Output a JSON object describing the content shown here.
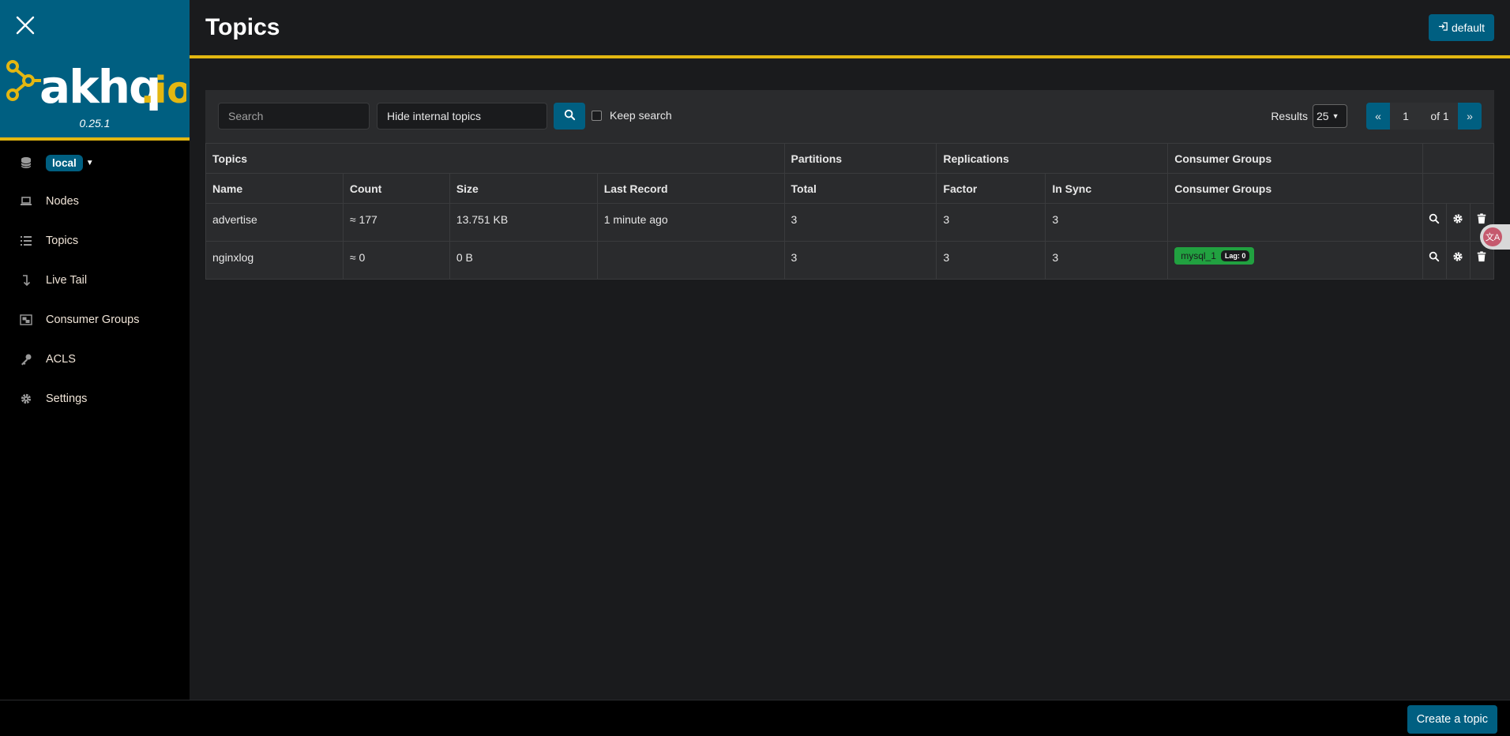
{
  "app": {
    "version": "0.25.1"
  },
  "sidebar": {
    "cluster": "local",
    "items": [
      {
        "label": "Nodes",
        "icon": "laptop-icon"
      },
      {
        "label": "Topics",
        "icon": "list-icon"
      },
      {
        "label": "Live Tail",
        "icon": "level-down-icon"
      },
      {
        "label": "Consumer Groups",
        "icon": "object-group-icon"
      },
      {
        "label": "ACLS",
        "icon": "key-icon"
      },
      {
        "label": "Settings",
        "icon": "gear-icon"
      }
    ]
  },
  "header": {
    "title": "Topics",
    "default_label": "default"
  },
  "search": {
    "placeholder": "Search",
    "internal_filter": "Hide internal topics",
    "keep_label": "Keep search",
    "results_label": "Results",
    "page_size": "25"
  },
  "pager": {
    "prev": "«",
    "current": "1",
    "total": "of 1",
    "next": "»"
  },
  "table": {
    "group_headers": [
      "Topics",
      "Partitions",
      "Replications",
      "Consumer Groups"
    ],
    "columns": [
      "Name",
      "Count",
      "Size",
      "Last Record",
      "Total",
      "Factor",
      "In Sync",
      "Consumer Groups"
    ],
    "rows": [
      {
        "name": "advertise",
        "count": "≈ 177",
        "size": "13.751 KB",
        "last_record": "1 minute ago",
        "total": "3",
        "factor": "3",
        "in_sync": "3",
        "consumer_group": "",
        "lag": ""
      },
      {
        "name": "nginxlog",
        "count": "≈ 0",
        "size": "0 B",
        "last_record": "",
        "total": "3",
        "factor": "3",
        "in_sync": "3",
        "consumer_group": "mysql_1",
        "lag": "Lag: 0"
      }
    ]
  },
  "footer": {
    "create_label": "Create a topic"
  },
  "colors": {
    "accent": "#e3b711",
    "brand": "#005f81",
    "success": "#21a140"
  }
}
